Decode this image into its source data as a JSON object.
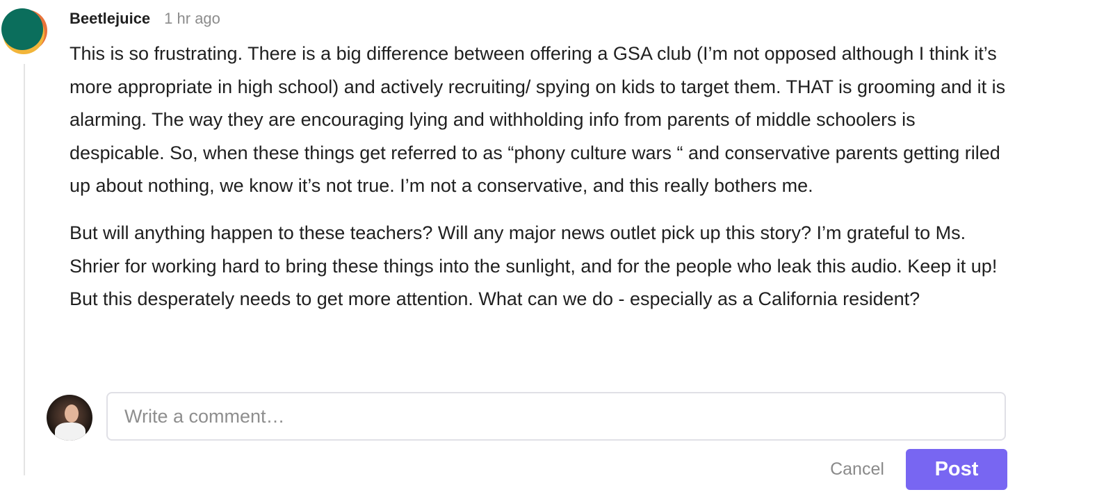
{
  "comment": {
    "author": "Beetlejuice",
    "timestamp": "1 hr ago",
    "paragraphs": [
      "This is so frustrating. There is a big difference between offering a GSA club (I’m not opposed although I think it’s more appropriate in high school) and actively recruiting/ spying on kids to target them. THAT is grooming and it is alarming. The way they are encouraging lying and withholding info from parents of middle schoolers is despicable. So, when these things get referred to as “phony culture wars “ and conservative parents getting riled up about nothing, we know it’s not true. I’m not a conservative, and this really bothers me.",
      "But will anything happen to these teachers? Will any major news outlet pick up this story? I’m grateful to Ms. Shrier for working hard to bring these things into the sunlight, and for the people who leak this audio. Keep it up! But this desperately needs to get more attention. What can we do - especially as a California resident?"
    ]
  },
  "reply": {
    "placeholder": "Write a comment…",
    "value": "",
    "cancel_label": "Cancel",
    "post_label": "Post"
  },
  "colors": {
    "accent": "#7866f2",
    "avatar_teal": "#0b6e5c",
    "avatar_orange": "#e8733a",
    "avatar_yellow": "#f2b53a"
  }
}
